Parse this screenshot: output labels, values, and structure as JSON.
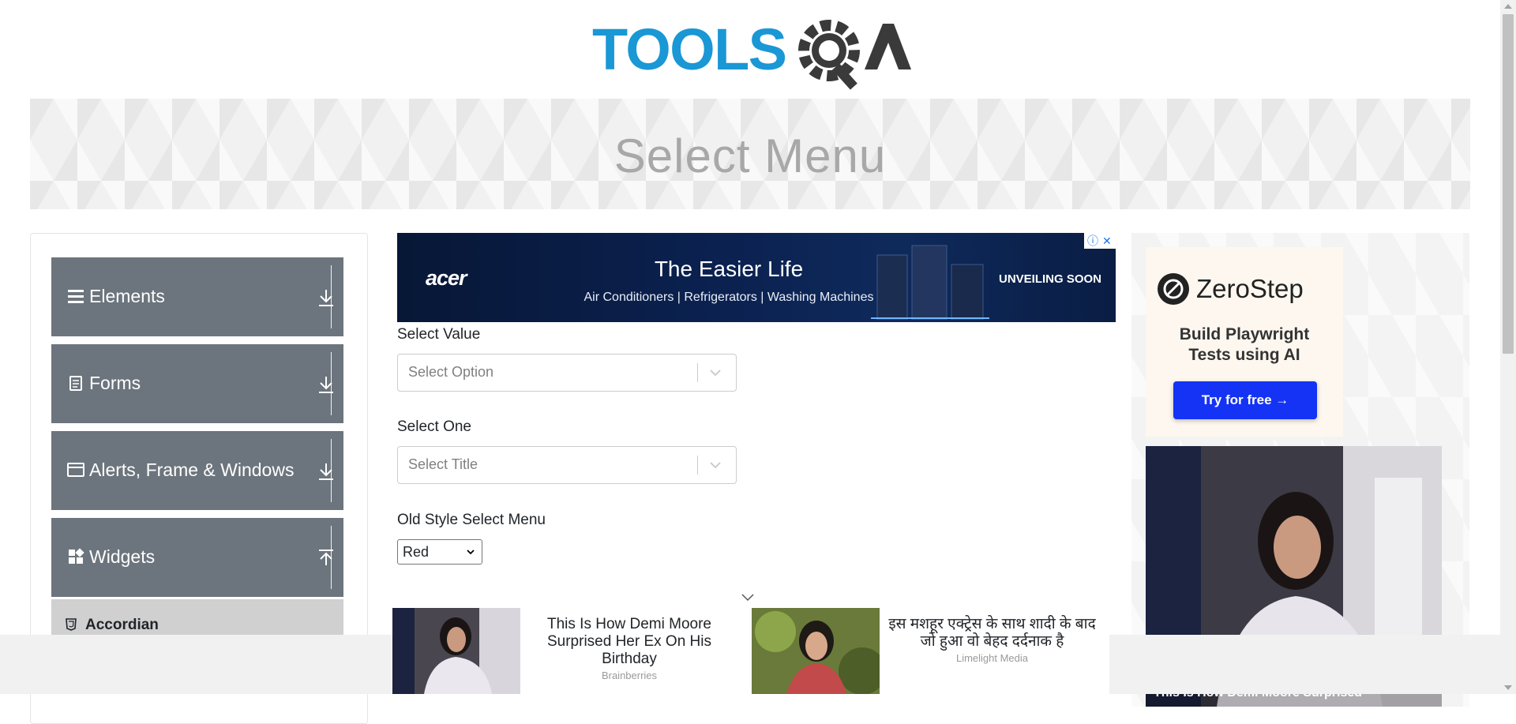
{
  "header": {
    "logo_text": "TOOLSQA",
    "page_title": "Select Menu"
  },
  "colors": {
    "sidebar_group": "#6c757d",
    "sidebar_item_active": "#d0d0d0",
    "logo_blue": "#1a97d5",
    "logo_dark": "#3a3a3a",
    "cta_blue": "#1433f5"
  },
  "sidebar": {
    "groups": [
      {
        "label": "Elements",
        "icon": "hamburger-icon",
        "state": "collapsed"
      },
      {
        "label": "Forms",
        "icon": "document-icon",
        "state": "collapsed"
      },
      {
        "label": "Alerts, Frame & Windows",
        "icon": "window-icon",
        "state": "collapsed"
      },
      {
        "label": "Widgets",
        "icon": "widgets-icon",
        "state": "expanded"
      }
    ],
    "items": [
      {
        "label": "Accordian",
        "icon": "html5-icon"
      }
    ]
  },
  "ad_banner": {
    "brand": "acer",
    "headline": "The Easier Life",
    "subline": "Air Conditioners | Refrigerators | Washing Machines",
    "cta": "UNVEILING SOON"
  },
  "form": {
    "select_value": {
      "label": "Select Value",
      "placeholder": "Select Option"
    },
    "select_one": {
      "label": "Select One",
      "placeholder": "Select Title"
    },
    "old_style": {
      "label": "Old Style Select Menu",
      "selected": "Red"
    }
  },
  "right_ad": {
    "brand": "ZeroStep",
    "tagline_line1": "Build Playwright",
    "tagline_line2": "Tests using AI",
    "cta": "Try for free →",
    "photo_caption": "This Is How Demi Moore Surprised"
  },
  "bottom_ad": {
    "promo1_title": "This Is How Demi Moore Surprised Her Ex On His Birthday",
    "promo1_source": "Brainberries",
    "promo2_title": "इस मशहूर एक्ट्रेस के साथ शादी के बाद जो हुआ वो बेहद दर्दनाक है",
    "promo2_source": "Limelight Media"
  }
}
